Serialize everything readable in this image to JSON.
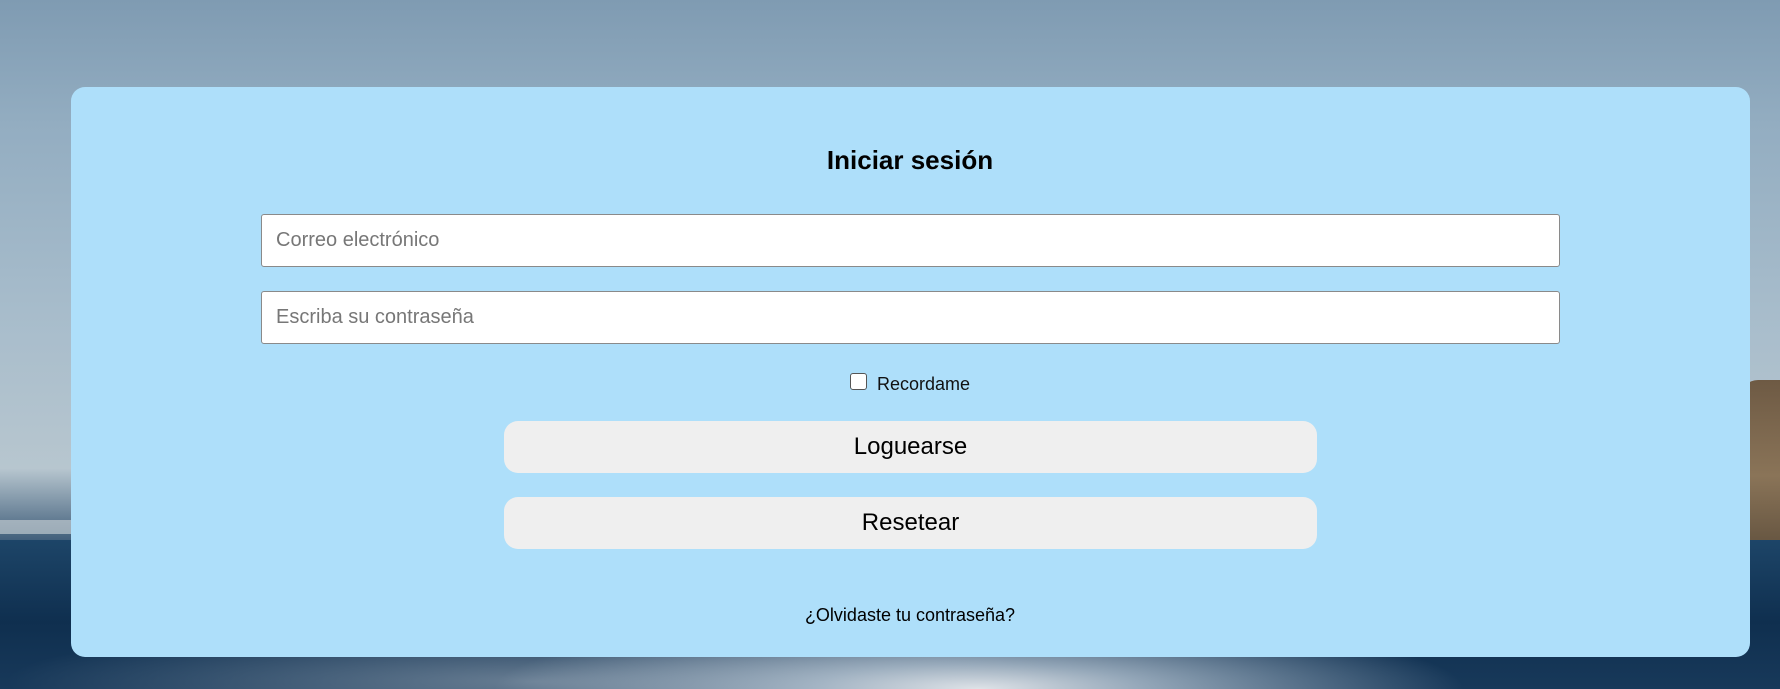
{
  "login": {
    "title": "Iniciar sesión",
    "email_placeholder": "Correo electrónico",
    "password_placeholder": "Escriba su contraseña",
    "remember_label": "Recordame",
    "remember_checked": false,
    "login_button": "Loguearse",
    "reset_button": "Resetear",
    "forgot_link": "¿Olvidaste tu contraseña?"
  },
  "colors": {
    "card_background": "#aedffa",
    "button_background": "#efefef",
    "input_border": "#8a8a8a"
  }
}
